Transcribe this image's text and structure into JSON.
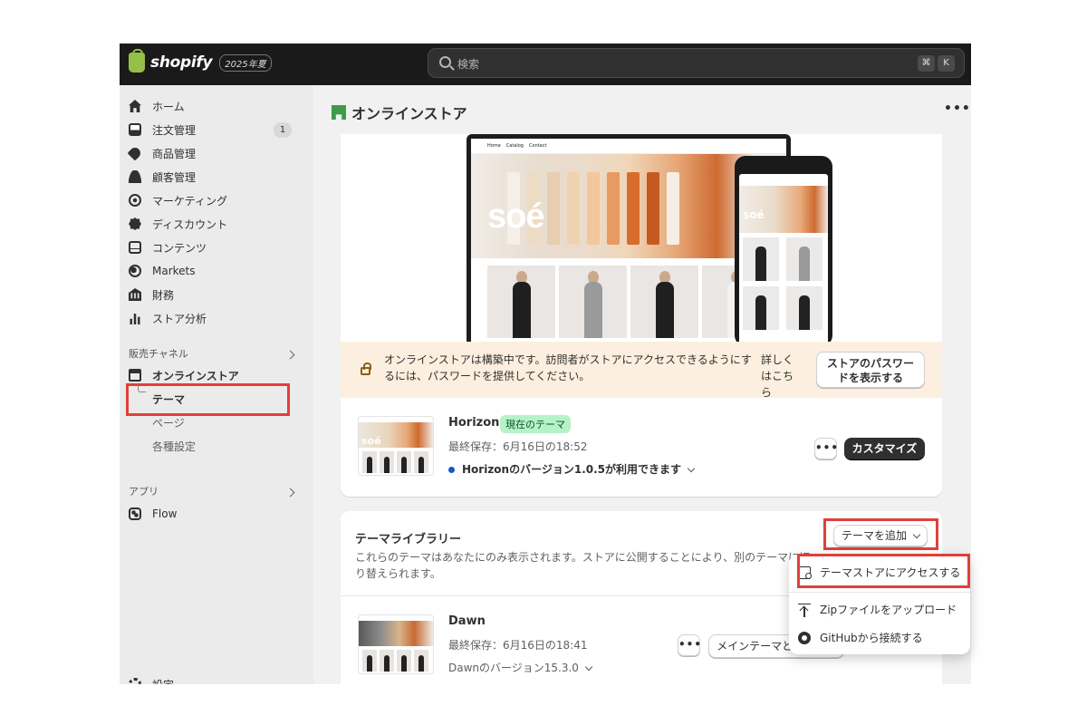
{
  "topbar": {
    "logo_text": "shopify",
    "edition": "2025年夏",
    "search_placeholder": "検索",
    "kbd_cmd": "⌘",
    "kbd_k": "K"
  },
  "sidebar": {
    "items": [
      {
        "label": "ホーム",
        "icon": "home-icon"
      },
      {
        "label": "注文管理",
        "icon": "orders-icon",
        "badge": "1"
      },
      {
        "label": "商品管理",
        "icon": "tag-icon"
      },
      {
        "label": "顧客管理",
        "icon": "person-icon"
      },
      {
        "label": "マーケティング",
        "icon": "target-icon"
      },
      {
        "label": "ディスカウント",
        "icon": "discount-icon"
      },
      {
        "label": "コンテンツ",
        "icon": "content-icon"
      },
      {
        "label": "Markets",
        "icon": "globe-icon"
      },
      {
        "label": "財務",
        "icon": "bank-icon"
      },
      {
        "label": "ストア分析",
        "icon": "chart-icon"
      }
    ],
    "sales_channels_title": "販売チャネル",
    "online_store_label": "オンラインストア",
    "sub_items": [
      "テーマ",
      "ページ",
      "各種設定"
    ],
    "apps_title": "アプリ",
    "flow_label": "Flow",
    "settings_label": "設定"
  },
  "main": {
    "page_title": "オンラインストア",
    "hero": {
      "laptop_nav": [
        "Home",
        "Catalog",
        "Contact"
      ],
      "brand_text": "soé"
    },
    "banner": {
      "text": "オンラインストアは構築中です。訪問者がストアにアクセスできるようにするには、パスワードを提供してください。",
      "link": "詳しくはこちら",
      "button": "ストアのパスワードを表示する"
    },
    "current_theme": {
      "name": "Horizon",
      "badge": "現在のテーマ",
      "saved": "最終保存：6月16日の18:52",
      "update": "Horizonのバージョン1.0.5が利用できます",
      "customize_button": "カスタマイズ",
      "more_button": "•••"
    },
    "library": {
      "title": "テーマライブラリー",
      "description": "これらのテーマはあなたにのみ表示されます。ストアに公開することにより、別のテーマに切り替えられます。",
      "add_button": "テーマを追加",
      "themes": [
        {
          "name": "Dawn",
          "saved": "最終保存：6月16日の18:41",
          "version": "Dawnのバージョン15.3.0",
          "publish_button": "メインテーマとして公開",
          "more_button": "•••"
        }
      ]
    },
    "dropdown": {
      "items": [
        {
          "label": "テーマストアにアクセスする",
          "icon": "storefront-icon"
        },
        {
          "label": "Zipファイルをアップロード",
          "icon": "upload-icon"
        },
        {
          "label": "GitHubから接続する",
          "icon": "github-icon"
        }
      ]
    },
    "colors": {
      "highlight": "#e0403a",
      "accent_green": "#b5f2c6",
      "banner_bg": "#fcefdf",
      "primary_button": "#303030"
    }
  }
}
